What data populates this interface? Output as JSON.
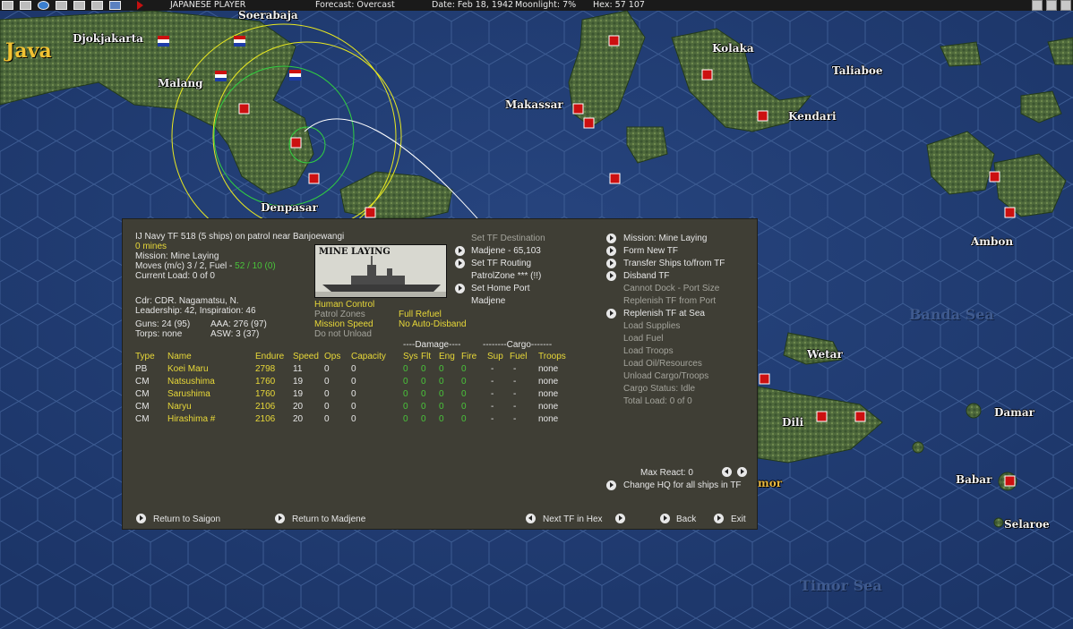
{
  "topbar": {
    "player": "JAPANESE PLAYER",
    "forecast": "Forecast: Overcast",
    "date": "Date: Feb 18, 1942",
    "moonlight": "Moonlight: 7%",
    "hex": "Hex: 57 107",
    "toolbar_icons": [
      "save-icon",
      "report-icon",
      "globe-icon",
      "ops-icon",
      "info-icon",
      "doc-icon",
      "window-icon",
      "end-turn-icon"
    ]
  },
  "map": {
    "region_title": "Java",
    "places": [
      "Djokjakarta",
      "Soerabaja",
      "Malang",
      "Denpasar",
      "Makassar",
      "Kolaka",
      "Taliaboe",
      "Kendari",
      "Ambon",
      "Wetar",
      "Dili",
      "Damar",
      "Babar",
      "Selaroe"
    ],
    "seas": [
      "Banda Sea",
      "Timor Sea"
    ],
    "timor_fragment": "mor"
  },
  "panel": {
    "tf_header": "IJ Navy TF 518 (5 ships)  on patrol near Banjoewangi",
    "mines": "0 mines",
    "mission": "Mission: Mine Laying",
    "moves_prefix": "Moves (m/c) 3 / 2, Fuel - ",
    "fuel_value": "52 / 10 (0)",
    "current_load": "Current Load: 0 of 0",
    "cdr": "Cdr: CDR. Nagamatsu, N.",
    "leadership": "Leadership: 42, Inspiration: 46",
    "guns": "Guns: 24 (95)",
    "aaa": "AAA: 276 (97)",
    "torps": "Torps: none",
    "asw": "ASW: 3 (37)",
    "picture_caption": "MINE LAYING",
    "control": {
      "human_control": "Human Control",
      "patrol_zones": "Patrol Zones",
      "mission_speed": "Mission Speed",
      "do_not_unload": "Do not Unload",
      "full_refuel": "Full Refuel",
      "no_auto_disband": "No Auto-Disband"
    },
    "destination": {
      "set_dest": "Set TF Destination",
      "dest_value": "Madjene - 65,103",
      "set_routing": "Set TF Routing",
      "patrol_zone": "PatrolZone *** (!!)",
      "set_home": "Set Home Port",
      "home_value": "Madjene"
    },
    "right_menu": [
      {
        "label": "Mission: Mine Laying",
        "enabled": true
      },
      {
        "label": "Form New TF",
        "enabled": true
      },
      {
        "label": "Transfer Ships to/from TF",
        "enabled": true
      },
      {
        "label": "Disband TF",
        "enabled": true
      },
      {
        "label": "Cannot Dock - Port Size",
        "enabled": false
      },
      {
        "label": "Replenish TF from Port",
        "enabled": false
      },
      {
        "label": "Replenish TF at Sea",
        "enabled": true
      },
      {
        "label": "Load Supplies",
        "enabled": false
      },
      {
        "label": "Load Fuel",
        "enabled": false
      },
      {
        "label": "Load Troops",
        "enabled": false
      },
      {
        "label": "Load Oil/Resources",
        "enabled": false
      },
      {
        "label": "Unload Cargo/Troops",
        "enabled": false
      },
      {
        "label": "Cargo Status: Idle",
        "enabled": false
      },
      {
        "label": "Total Load: 0 of 0",
        "enabled": false
      }
    ],
    "table": {
      "group_damage": "----Damage----",
      "group_cargo": "--------Cargo-------",
      "headers": [
        "Type",
        "Name",
        "Endure",
        "Speed",
        "Ops",
        "Capacity",
        "Sys",
        "Flt",
        "Eng",
        "Fire",
        "Sup",
        "Fuel",
        "Troops"
      ],
      "rows": [
        {
          "type": "PB",
          "name": "Koei Maru",
          "endure": "2798",
          "speed": "11",
          "ops": "0",
          "capacity": "0",
          "sys": "0",
          "flt": "0",
          "eng": "0",
          "fire": "0",
          "sup": "-",
          "fuel": "-",
          "troops": "none"
        },
        {
          "type": "CM",
          "name": "Natsushima",
          "endure": "1760",
          "speed": "19",
          "ops": "0",
          "capacity": "0",
          "sys": "0",
          "flt": "0",
          "eng": "0",
          "fire": "0",
          "sup": "-",
          "fuel": "-",
          "troops": "none"
        },
        {
          "type": "CM",
          "name": "Sarushima",
          "endure": "1760",
          "speed": "19",
          "ops": "0",
          "capacity": "0",
          "sys": "0",
          "flt": "0",
          "eng": "0",
          "fire": "0",
          "sup": "-",
          "fuel": "-",
          "troops": "none"
        },
        {
          "type": "CM",
          "name": "Naryu",
          "endure": "2106",
          "speed": "20",
          "ops": "0",
          "capacity": "0",
          "sys": "0",
          "flt": "0",
          "eng": "0",
          "fire": "0",
          "sup": "-",
          "fuel": "-",
          "troops": "none"
        },
        {
          "type": "CM",
          "name": "Hirashima #",
          "endure": "2106",
          "speed": "20",
          "ops": "0",
          "capacity": "0",
          "sys": "0",
          "flt": "0",
          "eng": "0",
          "fire": "0",
          "sup": "-",
          "fuel": "-",
          "troops": "none"
        }
      ]
    },
    "max_react_label": "Max React:",
    "max_react_value": "0",
    "change_hq": "Change HQ for all ships in TF",
    "bottom": {
      "return_saigon": "Return to Saigon",
      "return_madjene": "Return to Madjene",
      "next_tf": "Next TF in Hex",
      "back": "Back",
      "exit": "Exit"
    }
  }
}
